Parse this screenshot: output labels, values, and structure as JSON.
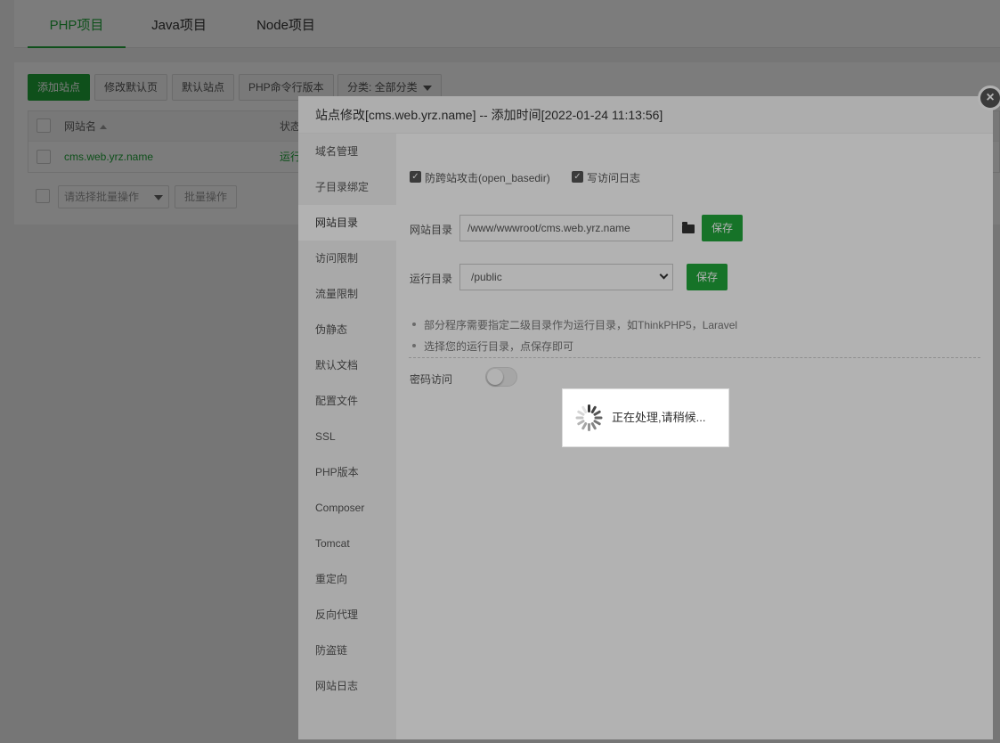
{
  "tabs": [
    {
      "label": "PHP项目",
      "active": true
    },
    {
      "label": "Java项目",
      "active": false
    },
    {
      "label": "Node项目",
      "active": false
    }
  ],
  "toolbar": {
    "add_site": "添加站点",
    "edit_default": "修改默认页",
    "default_site": "默认站点",
    "php_cli": "PHP命令行版本",
    "category": "分类: 全部分类"
  },
  "table": {
    "headers": {
      "name": "网站名",
      "status": "状态"
    },
    "rows": [
      {
        "name": "cms.web.yrz.name",
        "status": "运行"
      }
    ],
    "batch_placeholder": "请选择批量操作",
    "batch_button": "批量操作"
  },
  "dialog": {
    "title": "站点修改[cms.web.yrz.name] -- 添加时间[2022-01-24 11:13:56]",
    "close_glyph": "×",
    "sidebar": [
      {
        "label": "域名管理",
        "active": false
      },
      {
        "label": "子目录绑定",
        "active": false
      },
      {
        "label": "网站目录",
        "active": true
      },
      {
        "label": "访问限制",
        "active": false
      },
      {
        "label": "流量限制",
        "active": false
      },
      {
        "label": "伪静态",
        "active": false
      },
      {
        "label": "默认文档",
        "active": false
      },
      {
        "label": "配置文件",
        "active": false
      },
      {
        "label": "SSL",
        "active": false
      },
      {
        "label": "PHP版本",
        "active": false
      },
      {
        "label": "Composer",
        "active": false
      },
      {
        "label": "Tomcat",
        "active": false
      },
      {
        "label": "重定向",
        "active": false
      },
      {
        "label": "反向代理",
        "active": false
      },
      {
        "label": "防盗链",
        "active": false
      },
      {
        "label": "网站日志",
        "active": false
      }
    ],
    "content": {
      "anti_cross_label": "防跨站攻击(open_basedir)",
      "anti_cross_checked": true,
      "access_log_label": "写访问日志",
      "access_log_checked": true,
      "site_dir_label": "网站目录",
      "site_dir_value": "/www/wwwroot/cms.web.yrz.name",
      "save_label": "保存",
      "run_dir_label": "运行目录",
      "run_dir_value": "/public",
      "tips": [
        "部分程序需要指定二级目录作为运行目录，如ThinkPHP5，Laravel",
        "选择您的运行目录，点保存即可"
      ],
      "password_access_label": "密码访问",
      "password_access_on": false
    }
  },
  "loading": {
    "text": "正在处理,请稍候..."
  },
  "colors": {
    "accent": "#20a53a"
  }
}
